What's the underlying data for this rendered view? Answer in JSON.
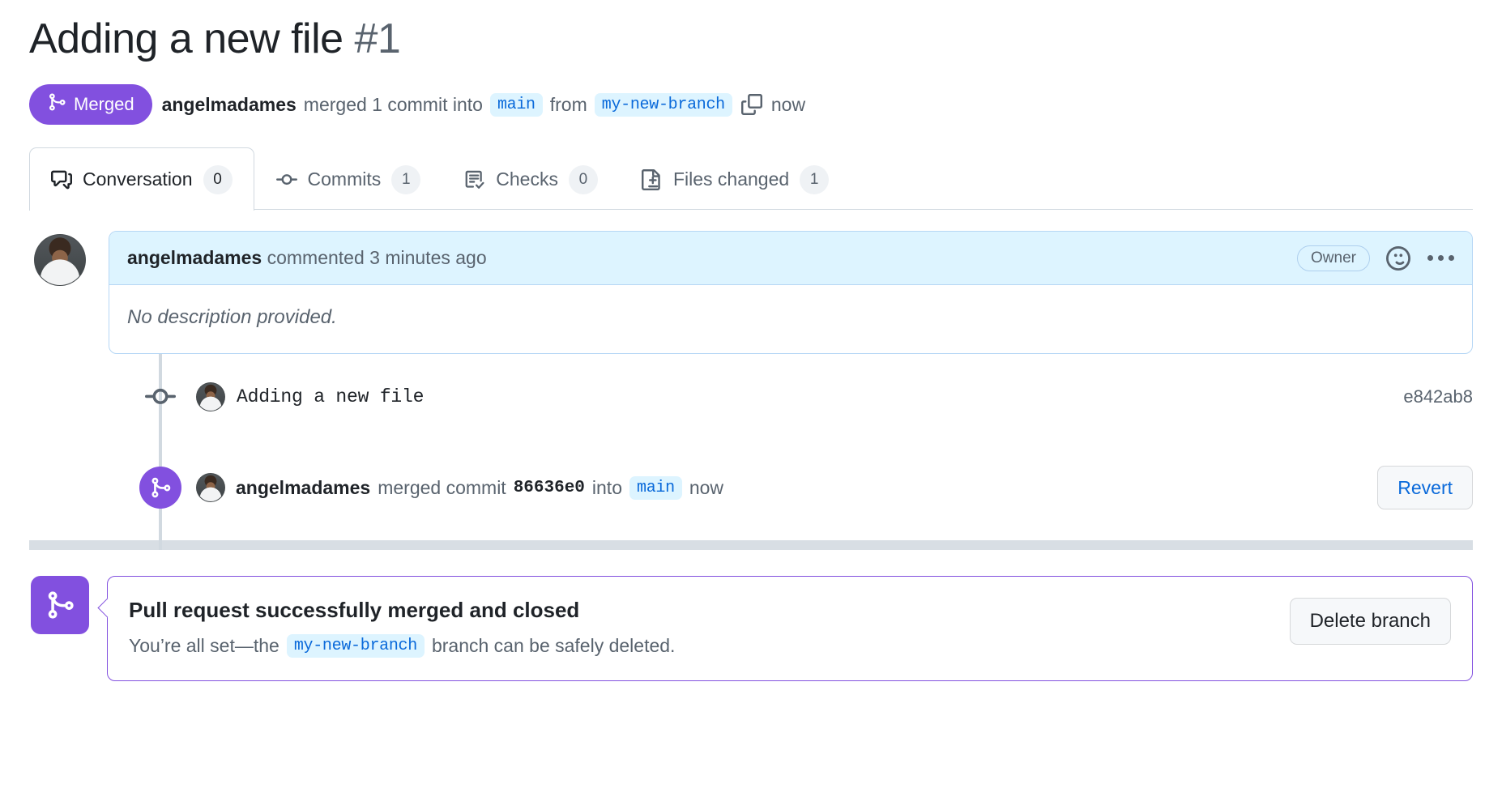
{
  "pull_request": {
    "title": "Adding a new file",
    "number": "#1",
    "state_badge": {
      "label": "Merged",
      "icon": "git-merge-icon",
      "color": "#8250df"
    },
    "subtitle": {
      "author": "angelmadames",
      "merged_text": "merged 1 commit into",
      "base_branch": "main",
      "from_text": "from",
      "head_branch": "my-new-branch",
      "copy_icon": "copy-icon",
      "time": "now"
    }
  },
  "tabs": [
    {
      "label": "Conversation",
      "count": "0",
      "icon": "comment-discussion-icon",
      "active": true
    },
    {
      "label": "Commits",
      "count": "1",
      "icon": "git-commit-icon",
      "active": false
    },
    {
      "label": "Checks",
      "count": "0",
      "icon": "checklist-check-icon",
      "active": false
    },
    {
      "label": "Files changed",
      "count": "1",
      "icon": "file-diff-icon",
      "active": false
    }
  ],
  "comment": {
    "avatar": "user-avatar",
    "author": "angelmadames",
    "action": "commented 3 minutes ago",
    "role_badge": "Owner",
    "reaction_icon": "smiley-icon",
    "menu_icon": "kebab-horizontal-icon",
    "body": "No description provided."
  },
  "timeline": {
    "commit_event": {
      "node_icon": "git-commit-node-icon",
      "avatar": "user-avatar",
      "message": "Adding a new file",
      "sha": "e842ab8"
    },
    "merge_event": {
      "node_icon": "git-merge-icon",
      "avatar": "user-avatar",
      "author": "angelmadames",
      "action": "merged commit",
      "sha": "86636e0",
      "into_text": "into",
      "branch": "main",
      "time": "now",
      "revert_label": "Revert"
    }
  },
  "merged_banner": {
    "icon": "git-merge-icon",
    "title": "Pull request successfully merged and closed",
    "description_prefix": "You’re all set—the",
    "branch": "my-new-branch",
    "description_suffix": "branch can be safely deleted.",
    "delete_label": "Delete branch"
  }
}
